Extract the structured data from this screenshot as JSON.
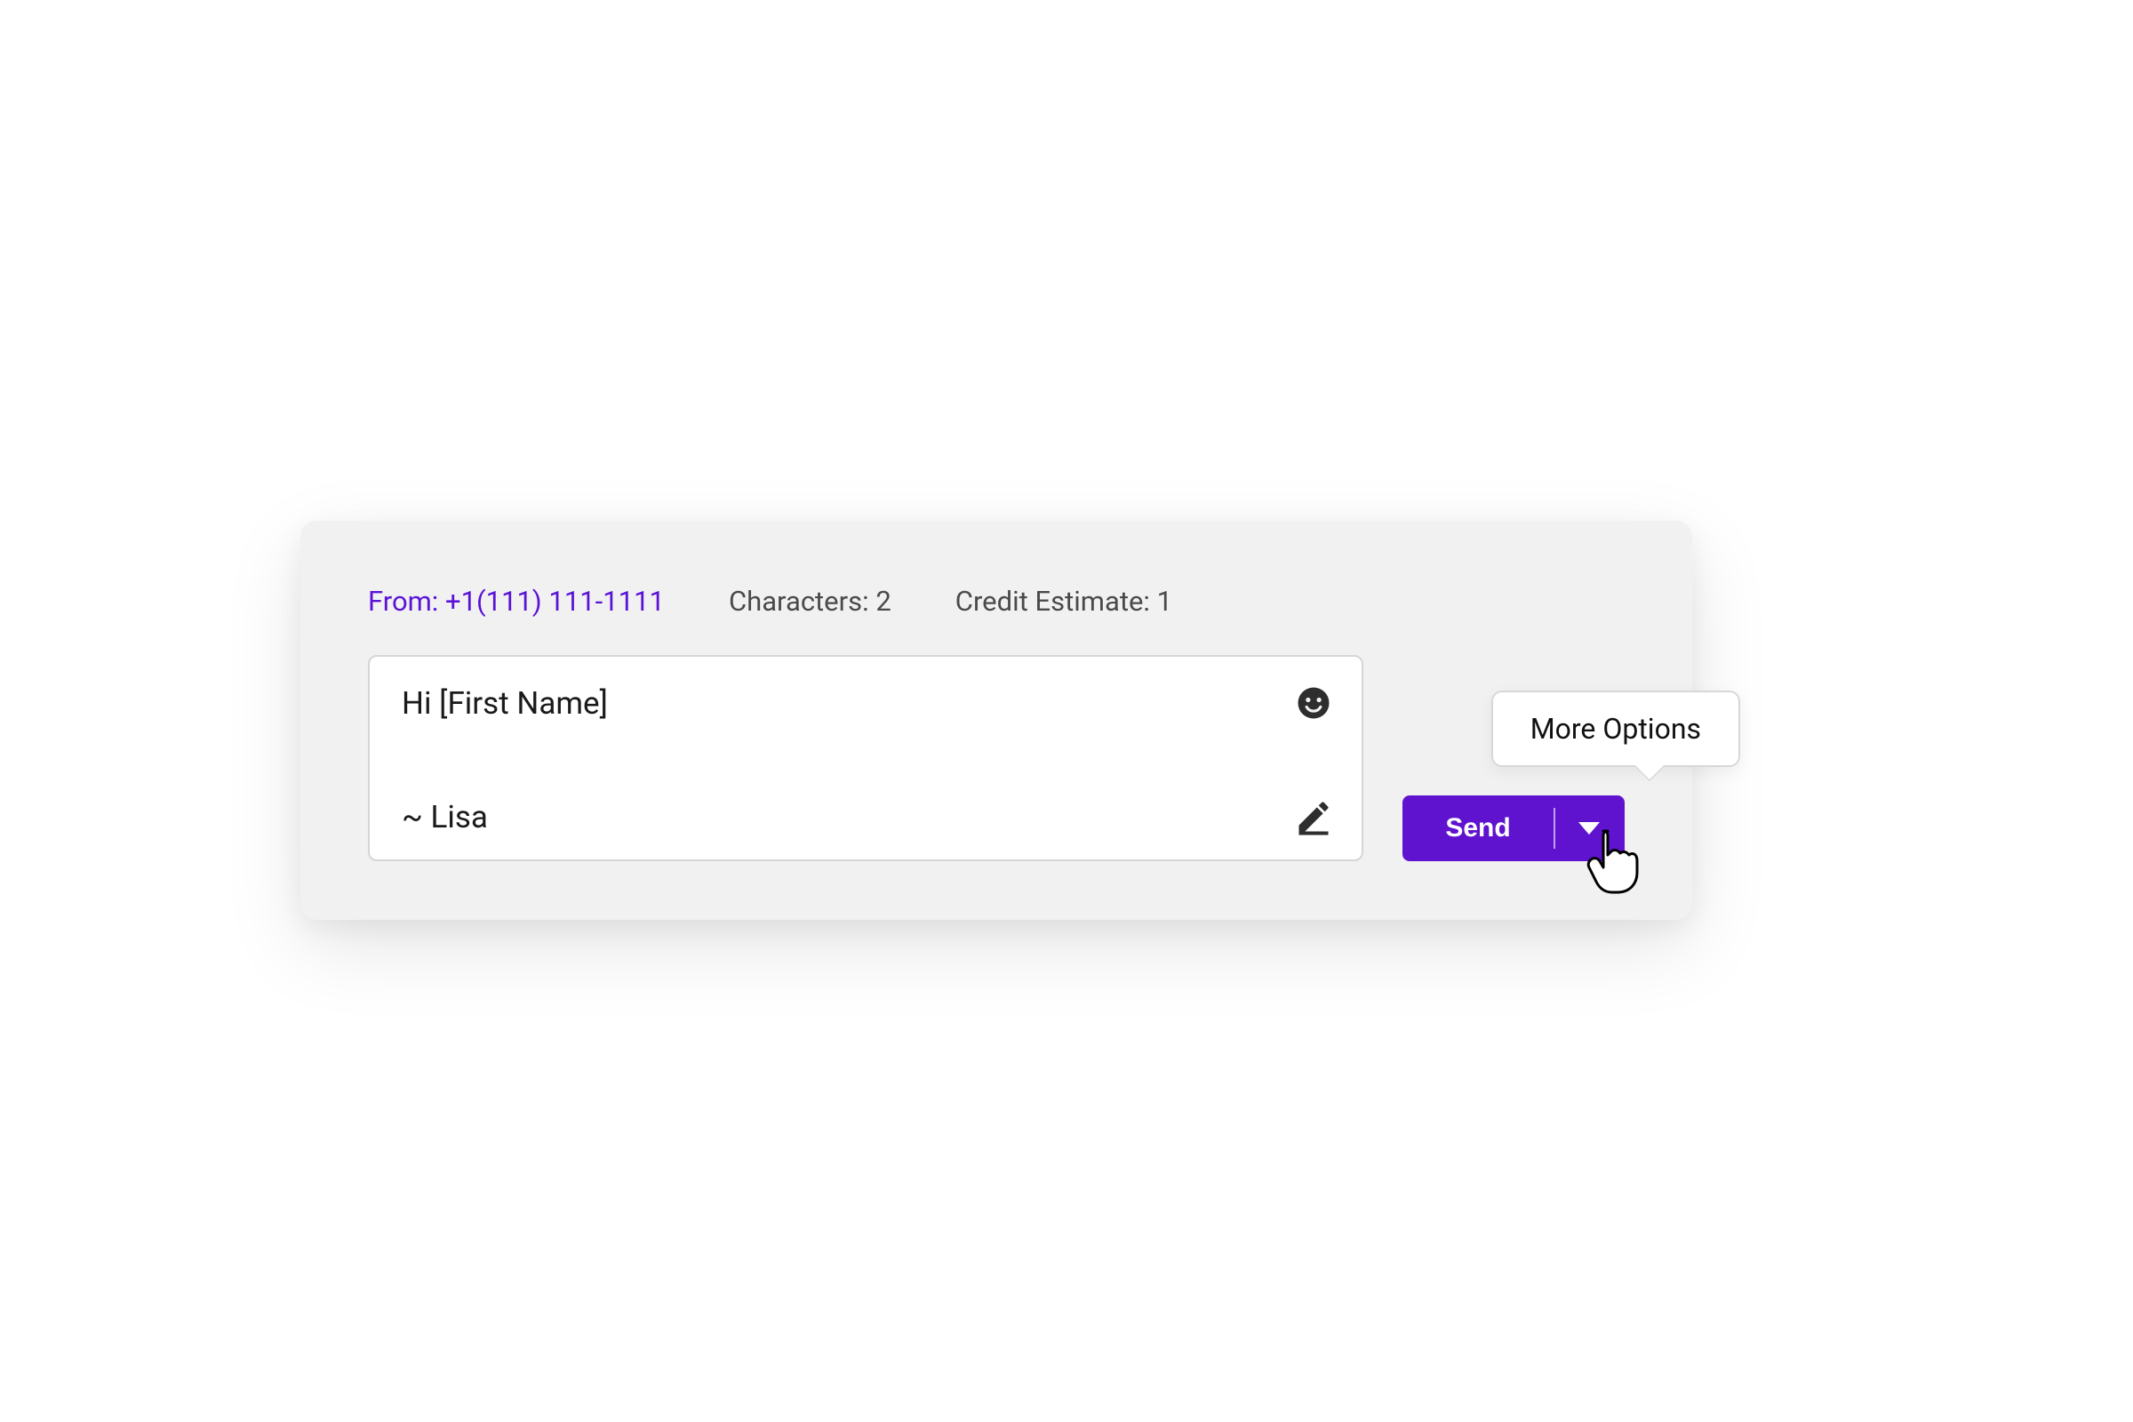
{
  "meta": {
    "from_label": "From:",
    "from_number": "+1(111) 111-1111",
    "characters_label": "Characters:",
    "characters_value": "2",
    "credit_label": "Credit Estimate:",
    "credit_value": "1"
  },
  "message": {
    "line1": "Hi [First Name]",
    "signature": "~ Lisa"
  },
  "actions": {
    "send_label": "Send",
    "more_options_tooltip": "More Options"
  },
  "icons": {
    "emoji": "emoji-icon",
    "edit": "edit-icon",
    "caret_down": "chevron-down-icon",
    "pointer": "pointer-cursor-icon"
  },
  "colors": {
    "accent": "#6013cf",
    "panel": "#f1f1f1",
    "border": "#d6d6d6"
  }
}
